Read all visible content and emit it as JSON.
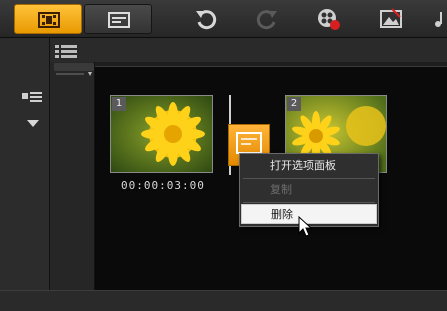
{
  "toolbar": {
    "view_buttons": [
      "storyboard-view",
      "timeline-view"
    ],
    "tools": [
      "undo-icon",
      "redo-icon",
      "record-capture-icon",
      "image-edit-icon",
      "music-icon"
    ]
  },
  "storyboard": {
    "clips": [
      {
        "number": "1",
        "duration": "00:00:03:00"
      },
      {
        "number": "2"
      }
    ]
  },
  "context_menu": {
    "items": [
      {
        "label": "打开选项面板",
        "enabled": true
      },
      {
        "label": "复制",
        "enabled": false
      },
      {
        "label": "删除",
        "enabled": true,
        "highlighted": true
      }
    ]
  },
  "colors": {
    "accent": "#f2a90f",
    "background": "#0a0a0a",
    "menu_highlight": "#f4f4f4"
  }
}
